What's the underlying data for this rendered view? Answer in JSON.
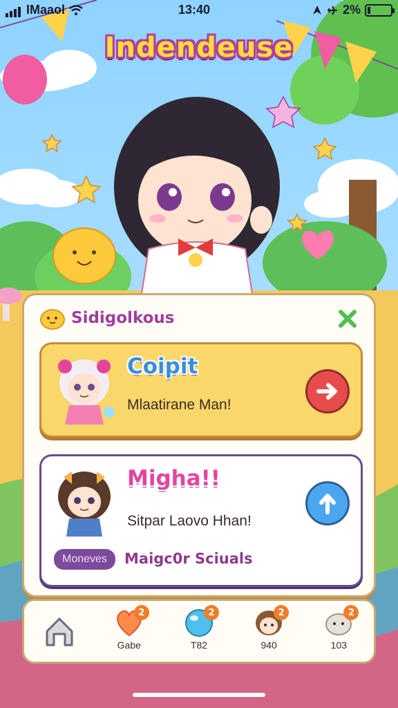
{
  "status_bar": {
    "carrier": "IMaaol",
    "time": "13:40",
    "battery": "2%"
  },
  "game_title": "Indendeuse",
  "panel": {
    "title": "Sidigolkous",
    "cards": [
      {
        "name": "Coipit",
        "subtitle": "Mlaatirane Man!",
        "action_icon": "arrow-right-icon",
        "accent": "#e84b4b"
      },
      {
        "name": "Migha!!",
        "subtitle": "Sitpar Laovo Hhan!",
        "action_icon": "arrow-up-icon",
        "accent": "#4aa6ee",
        "tag": "Moneves",
        "tag_desc": "Maigc0r Sciuals"
      }
    ]
  },
  "bottom_nav": {
    "items": [
      {
        "icon": "home-icon",
        "label": ""
      },
      {
        "icon": "heart-icon",
        "label": "Gabe",
        "badge": "2"
      },
      {
        "icon": "bubble-icon",
        "label": "T82",
        "badge": "2"
      },
      {
        "icon": "character-icon",
        "label": "940",
        "badge": "2"
      },
      {
        "icon": "pet-icon",
        "label": "103",
        "badge": "2"
      }
    ]
  },
  "colors": {
    "sky": "#9bd7ff",
    "title_fill": "#ffdc3c",
    "panel_bg": "#fffdf6",
    "card_yellow": "#f9d76a",
    "tag_purple": "#7c4b9c"
  }
}
